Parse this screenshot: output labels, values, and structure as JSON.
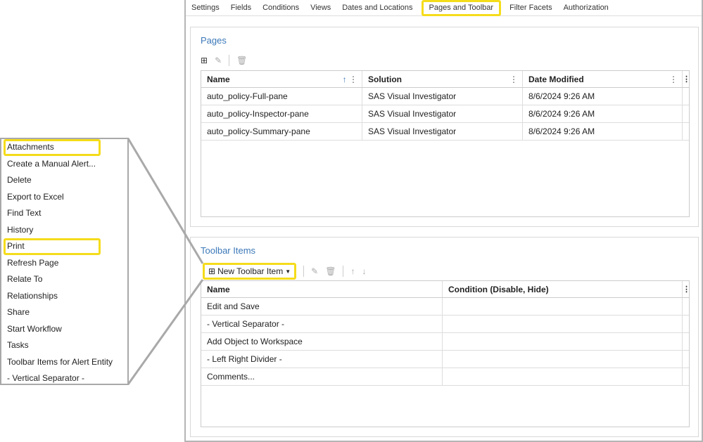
{
  "tabs": [
    "Settings",
    "Fields",
    "Conditions",
    "Views",
    "Dates and Locations",
    "Pages and Toolbar",
    "Filter Facets",
    "Authorization"
  ],
  "pages": {
    "title": "Pages",
    "columns": [
      "Name",
      "Solution",
      "Date Modified"
    ],
    "rows": [
      [
        "auto_policy-Full-pane",
        "SAS Visual Investigator",
        "8/6/2024 9:26 AM"
      ],
      [
        "auto_policy-Inspector-pane",
        "SAS Visual Investigator",
        "8/6/2024 9:26 AM"
      ],
      [
        "auto_policy-Summary-pane",
        "SAS Visual Investigator",
        "8/6/2024 9:26 AM"
      ]
    ]
  },
  "toolbar": {
    "title": "Toolbar Items",
    "new_label": "New Toolbar Item",
    "columns": [
      "Name",
      "Condition (Disable, Hide)"
    ],
    "rows": [
      "Edit and Save",
      "- Vertical Separator -",
      "Add Object to Workspace",
      "- Left Right Divider -",
      "Comments..."
    ]
  },
  "menu": [
    "Attachments",
    "Create a Manual Alert...",
    "Delete",
    "Export to Excel",
    "Find Text",
    "History",
    "Print",
    "Refresh Page",
    "Relate To",
    "Relationships",
    "Share",
    "Start Workflow",
    "Tasks",
    "Toolbar Items for Alert Entity",
    "- Vertical Separator -"
  ],
  "colors": {
    "highlight": "#f5dc1b",
    "title": "#3b78b8"
  }
}
